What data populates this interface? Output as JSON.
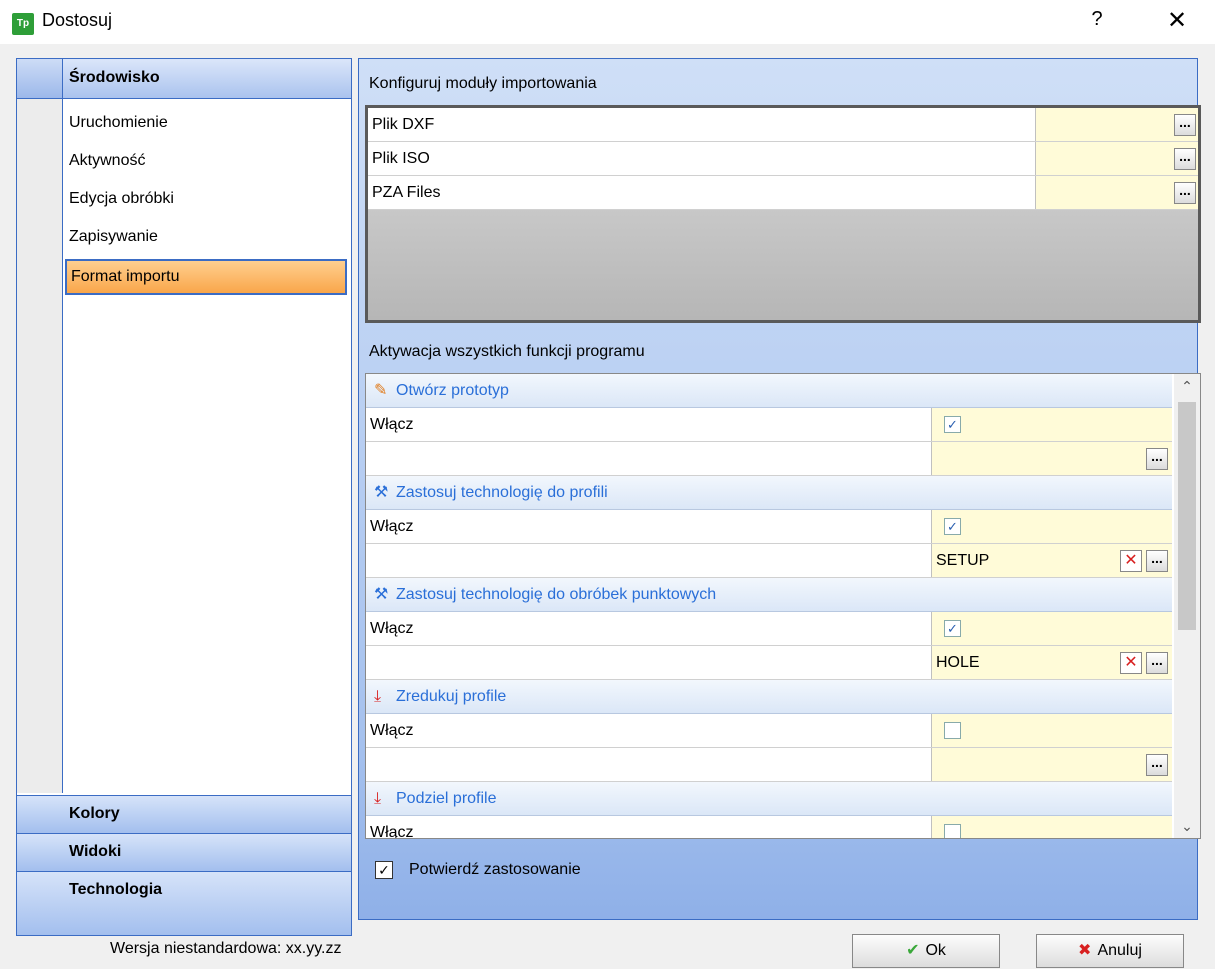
{
  "window": {
    "title": "Dostosuj",
    "help_label": "?",
    "close_label": "✕",
    "app_icon_text": "Tp"
  },
  "nav": {
    "header": "Środowisko",
    "items": [
      {
        "label": "Uruchomienie"
      },
      {
        "label": "Aktywność"
      },
      {
        "label": "Edycja obróbki"
      },
      {
        "label": "Zapisywanie"
      },
      {
        "label": "Format importu",
        "selected": true
      }
    ],
    "footers": [
      "Kolory",
      "Widoki",
      "Technologia"
    ]
  },
  "import_modules": {
    "title": "Konfiguruj moduły importowania",
    "rows": [
      {
        "name": "Plik DXF",
        "value": ""
      },
      {
        "name": "Plik ISO",
        "value": ""
      },
      {
        "name": "PZA Files",
        "value": ""
      }
    ],
    "dots_label": "..."
  },
  "functions": {
    "title": "Aktywacja wszystkich funkcji programu",
    "sections": [
      {
        "title": "Otwórz prototyp",
        "icon": "pencil-icon",
        "enable_label": "Włącz",
        "enabled": true,
        "value": ""
      },
      {
        "title": "Zastosuj technologię do profili",
        "icon": "hammer-icon",
        "enable_label": "Włącz",
        "enabled": true,
        "value": "SETUP"
      },
      {
        "title": "Zastosuj technologię do obróbek punktowych",
        "icon": "hammer-icon",
        "enable_label": "Włącz",
        "enabled": true,
        "value": "HOLE"
      },
      {
        "title": "Zredukuj profile",
        "icon": "arrow-down-icon",
        "enable_label": "Włącz",
        "enabled": false,
        "value": ""
      },
      {
        "title": "Podziel profile",
        "icon": "arrow-down-icon",
        "enable_label": "Włącz",
        "enabled": false,
        "value": ""
      }
    ]
  },
  "confirm": {
    "label": "Potwierdź zastosowanie",
    "checked": true
  },
  "status": {
    "version": "Wersja niestandardowa: xx.yy.zz"
  },
  "buttons": {
    "ok": "Ok",
    "cancel": "Anuluj"
  }
}
